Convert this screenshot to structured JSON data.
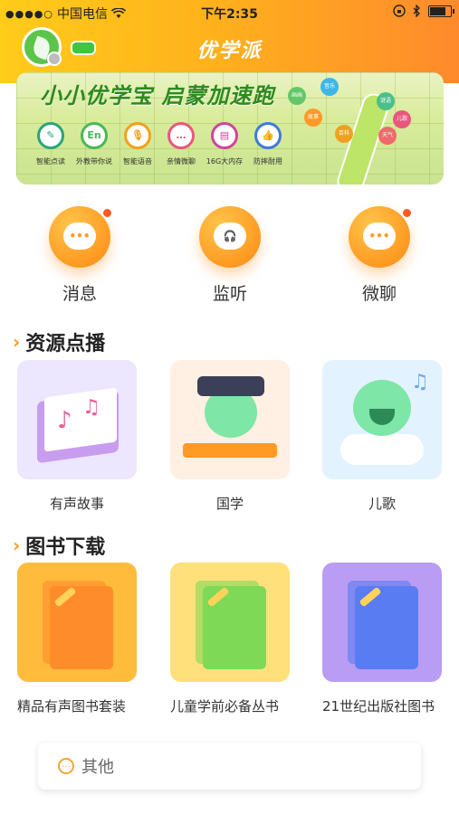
{
  "status_bar": {
    "carrier": "中国电信",
    "time": "下午2:35",
    "signal_dots": "●●●●○",
    "battery_level": 0.85
  },
  "nav": {
    "title": "优学派"
  },
  "banner": {
    "title": "小小优学宝 启蒙加速跑",
    "features": [
      {
        "label": "智能点读",
        "icon": "book-icon",
        "symbol": "✎",
        "color": "#2aa57a"
      },
      {
        "label": "外教带你说",
        "icon": "english-icon",
        "symbol": "En",
        "color": "#49b857"
      },
      {
        "label": "智能语音",
        "icon": "microphone-icon",
        "symbol": "🎙",
        "color": "#f2a019"
      },
      {
        "label": "亲情微聊",
        "icon": "chat-icon",
        "symbol": "…",
        "color": "#e8577e"
      },
      {
        "label": "16G大内存",
        "icon": "storage-icon",
        "symbol": "▤",
        "color": "#d0459c"
      },
      {
        "label": "防摔耐用",
        "icon": "thumbs-up-icon",
        "symbol": "👍",
        "color": "#3d7bd9"
      }
    ],
    "bubbles": [
      "画画",
      "音乐",
      "故事",
      "谜语",
      "儿歌",
      "百科",
      "天气"
    ]
  },
  "quick_actions": [
    {
      "label": "消息",
      "icon": "message-icon",
      "badge": true
    },
    {
      "label": "监听",
      "icon": "headset-icon",
      "badge": false
    },
    {
      "label": "微聊",
      "icon": "wechat-bubble-icon",
      "badge": true
    }
  ],
  "resources": {
    "title": "资源点播",
    "items": [
      {
        "label": "有声故事",
        "icon": "story-book-icon",
        "bg": "#ece6ff"
      },
      {
        "label": "国学",
        "icon": "scholar-icon",
        "bg": "#fff0e3"
      },
      {
        "label": "儿歌",
        "icon": "singing-robot-icon",
        "bg": "#e3f2ff"
      }
    ]
  },
  "books": {
    "title": "图书下载",
    "items": [
      {
        "label": "精品有声图书套装",
        "icon": "orange-folder-icon",
        "bg": "#ffbb3c",
        "fg": "#ff8c2a"
      },
      {
        "label": "儿童学前必备丛书",
        "icon": "green-folder-icon",
        "bg": "#ffe07a",
        "fg": "#7ed957"
      },
      {
        "label": "21世纪出版社图书",
        "icon": "blue-folder-icon",
        "bg": "#b99cf3",
        "fg": "#5a7cf2"
      }
    ]
  },
  "other": {
    "label": "其他"
  }
}
